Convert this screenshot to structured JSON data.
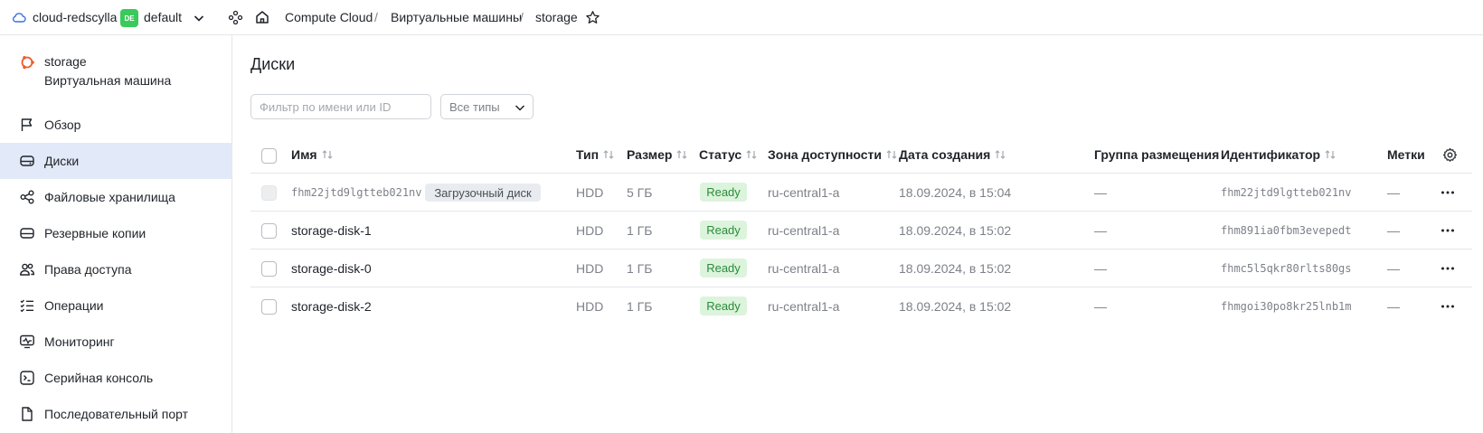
{
  "topbar": {
    "cloud_name": "cloud-redscylla",
    "folder_badge": "DE",
    "folder_name": "default",
    "breadcrumbs": [
      "Compute Cloud",
      "Виртуальные машины",
      "storage"
    ],
    "separator": "/"
  },
  "sidebar": {
    "vm_name": "storage",
    "vm_type": "Виртуальная машина",
    "items": [
      {
        "label": "Обзор",
        "icon": "flag-icon"
      },
      {
        "label": "Диски",
        "icon": "disk-icon",
        "active": true
      },
      {
        "label": "Файловые хранилища",
        "icon": "share-icon"
      },
      {
        "label": "Резервные копии",
        "icon": "backup-icon"
      },
      {
        "label": "Права доступа",
        "icon": "users-icon"
      },
      {
        "label": "Операции",
        "icon": "list-check-icon"
      },
      {
        "label": "Мониторинг",
        "icon": "monitor-icon"
      },
      {
        "label": "Серийная консоль",
        "icon": "terminal-icon"
      },
      {
        "label": "Последовательный порт",
        "icon": "file-icon"
      }
    ]
  },
  "main": {
    "title": "Диски",
    "filter_placeholder": "Фильтр по имени или ID",
    "type_select": "Все типы",
    "columns": {
      "name": "Имя",
      "type": "Тип",
      "size": "Размер",
      "status": "Статус",
      "zone": "Зона доступности",
      "created": "Дата создания",
      "placement": "Группа размещения",
      "id": "Идентификатор",
      "labels": "Метки"
    },
    "rows": [
      {
        "name": "fhm22jtd9lgtteb021nv",
        "boot": "Загрузочный диск",
        "type": "HDD",
        "size": "5 ГБ",
        "status": "Ready",
        "zone": "ru-central1-a",
        "created": "18.09.2024, в 15:04",
        "placement": "—",
        "id": "fhm22jtd9lgtteb021nv",
        "labels": "—"
      },
      {
        "name": "storage-disk-1",
        "type": "HDD",
        "size": "1 ГБ",
        "status": "Ready",
        "zone": "ru-central1-a",
        "created": "18.09.2024, в 15:02",
        "placement": "—",
        "id": "fhm891ia0fbm3evepedt",
        "labels": "—"
      },
      {
        "name": "storage-disk-0",
        "type": "HDD",
        "size": "1 ГБ",
        "status": "Ready",
        "zone": "ru-central1-a",
        "created": "18.09.2024, в 15:02",
        "placement": "—",
        "id": "fhmc5l5qkr80rlts80gs",
        "labels": "—"
      },
      {
        "name": "storage-disk-2",
        "type": "HDD",
        "size": "1 ГБ",
        "status": "Ready",
        "zone": "ru-central1-a",
        "created": "18.09.2024, в 15:02",
        "placement": "—",
        "id": "fhmgoi30po8kr25lnb1m",
        "labels": "—"
      }
    ]
  },
  "colors": {
    "accent": "#3bc95b",
    "active_nav": "#e2e9f8",
    "status_bg": "#dcf4dc",
    "status_text": "#2b8a3b",
    "vm_icon": "#f05a28"
  }
}
